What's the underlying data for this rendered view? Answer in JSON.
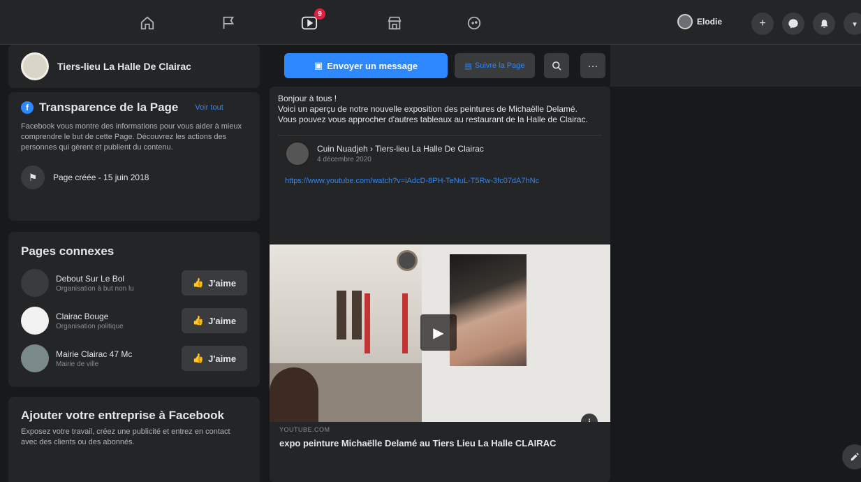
{
  "topnav": {
    "icons": [
      "home-icon",
      "flag-icon",
      "watch-icon",
      "marketplace-icon",
      "gaming-icon"
    ],
    "watch_badge": "9",
    "profile_name": "Elodie"
  },
  "page": {
    "name": "Tiers-lieu La Halle De Clairac"
  },
  "transparency": {
    "title": "Transparence de la Page",
    "see_all": "Voir tout",
    "body": "Facebook vous montre des informations pour vous aider à mieux comprendre le but de cette Page. Découvrez les actions des personnes qui gèrent et publient du contenu.",
    "created": "Page créée - 15 juin 2018"
  },
  "connected": {
    "title": "Pages connexes",
    "like_label": "J'aime",
    "items": [
      {
        "name": "Debout Sur Le Bol",
        "sub": "Organisation à but non lu"
      },
      {
        "name": "Clairac Bouge",
        "sub": "Organisation politique"
      },
      {
        "name": "Mairie Clairac 47 Mc",
        "sub": "Mairie de ville"
      }
    ]
  },
  "business": {
    "title": "Ajouter votre entreprise à Facebook",
    "body": "Exposez votre travail, créez une publicité et entrez en contact avec des clients ou des abonnés."
  },
  "actions": {
    "message": "Envoyer un message",
    "follow": "Suivre la Page"
  },
  "post": {
    "text_lines": [
      "Bonjour à tous !",
      "Voici un aperçu de notre nouvelle exposition des peintures de Michaëlle Delamé.",
      "Vous pouvez vous approcher d'autres tableaux au restaurant de la Halle de Clairac."
    ],
    "shared_author": "Cuin Nuadjeh › Tiers-lieu La Halle De Clairac",
    "shared_date": "4 décembre 2020",
    "shared_link": "https://www.youtube.com/watch?v=iAdcD-8PH-TeNuL-T5Rw-3fc07dA7hNc",
    "video_source": "YOUTUBE.COM",
    "video_title": "expo peinture Michaëlle Delamé au Tiers Lieu La Halle CLAIRAC"
  }
}
